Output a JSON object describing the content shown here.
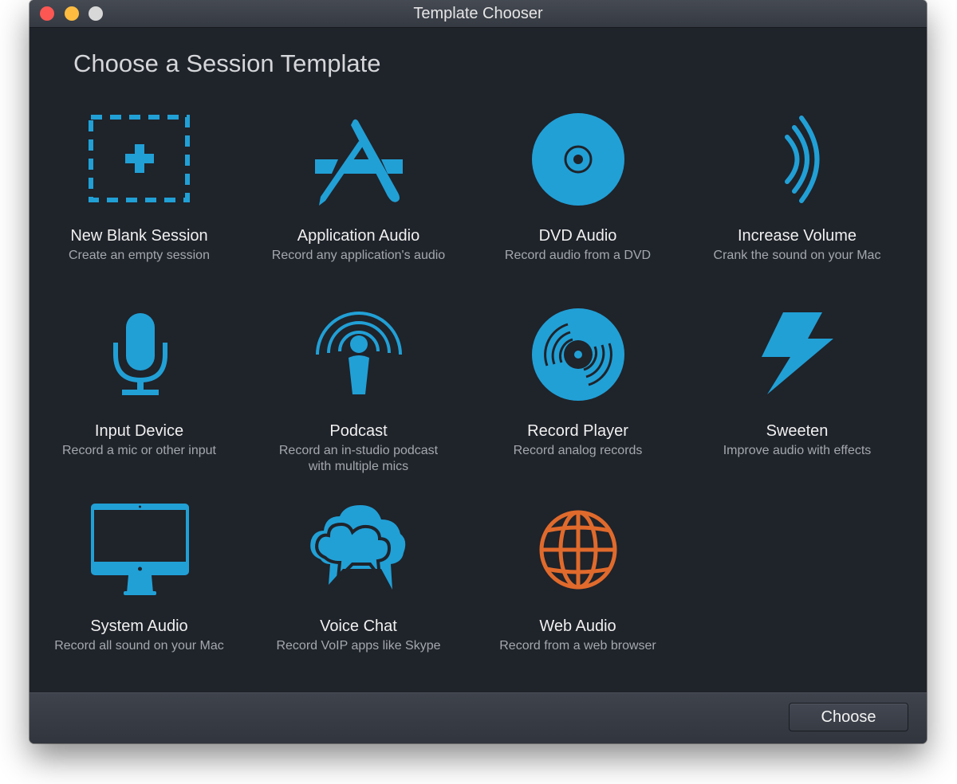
{
  "window": {
    "title": "Template Chooser",
    "traffic_lights": [
      "close",
      "minimize",
      "zoom"
    ]
  },
  "heading": "Choose a Session Template",
  "colors": {
    "accent": "#21a0d6",
    "web_accent": "#e06a2c",
    "background": "#1f232a"
  },
  "templates": [
    {
      "name": "New Blank Session",
      "desc": "Create an empty session",
      "icon": "dashed-plus-icon"
    },
    {
      "name": "Application Audio",
      "desc": "Record any application's audio",
      "icon": "app-store-icon"
    },
    {
      "name": "DVD Audio",
      "desc": "Record audio from a DVD",
      "icon": "dvd-icon"
    },
    {
      "name": "Increase Volume",
      "desc": "Crank the sound on your Mac",
      "icon": "sound-waves-icon"
    },
    {
      "name": "Input Device",
      "desc": "Record a mic or other input",
      "icon": "microphone-icon"
    },
    {
      "name": "Podcast",
      "desc": "Record an in-studio podcast with multiple mics",
      "icon": "podcast-icon"
    },
    {
      "name": "Record Player",
      "desc": "Record analog records",
      "icon": "vinyl-record-icon"
    },
    {
      "name": "Sweeten",
      "desc": "Improve audio with effects",
      "icon": "lightning-bolt-icon"
    },
    {
      "name": "System Audio",
      "desc": "Record all sound on your Mac",
      "icon": "imac-icon"
    },
    {
      "name": "Voice Chat",
      "desc": "Record VoIP apps like Skype",
      "icon": "chat-clouds-icon"
    },
    {
      "name": "Web Audio",
      "desc": "Record from a web browser",
      "icon": "globe-icon"
    }
  ],
  "footer": {
    "choose_label": "Choose"
  }
}
